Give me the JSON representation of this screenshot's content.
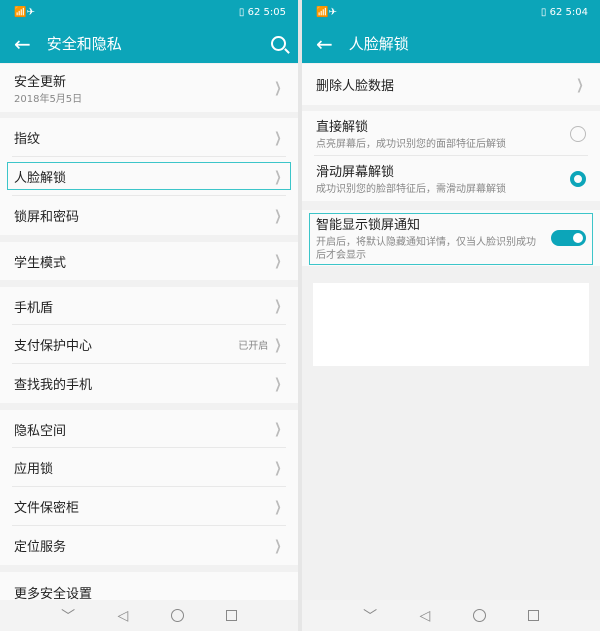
{
  "left": {
    "status": {
      "icons": "wifi airplane",
      "battery": "62",
      "time": "5:05"
    },
    "title": "安全和隐私",
    "items": [
      {
        "label": "安全更新",
        "sub": "2018年5月5日"
      },
      {
        "label": "指纹"
      },
      {
        "label": "人脸解锁"
      },
      {
        "label": "锁屏和密码"
      },
      {
        "label": "学生模式"
      },
      {
        "label": "手机盾"
      },
      {
        "label": "支付保护中心",
        "value": "已开启"
      },
      {
        "label": "查找我的手机"
      },
      {
        "label": "隐私空间"
      },
      {
        "label": "应用锁"
      },
      {
        "label": "文件保密柜"
      },
      {
        "label": "定位服务"
      },
      {
        "label": "更多安全设置"
      }
    ]
  },
  "right": {
    "status": {
      "icons": "wifi airplane",
      "battery": "62",
      "time": "5:04"
    },
    "title": "人脸解锁",
    "delete": "删除人脸数据",
    "options": [
      {
        "label": "直接解锁",
        "sub": "点亮屏幕后，成功识别您的面部特征后解锁",
        "selected": false
      },
      {
        "label": "滑动屏幕解锁",
        "sub": "成功识别您的脸部特征后，需滑动屏幕解锁",
        "selected": true
      }
    ],
    "smart": {
      "label": "智能显示锁屏通知",
      "sub": "开启后，将默认隐藏通知详情，仅当人脸识别成功后才会显示",
      "on": true
    }
  },
  "nav": {
    "back": "◁",
    "home": "○",
    "recent": "□",
    "down": "﹀"
  }
}
